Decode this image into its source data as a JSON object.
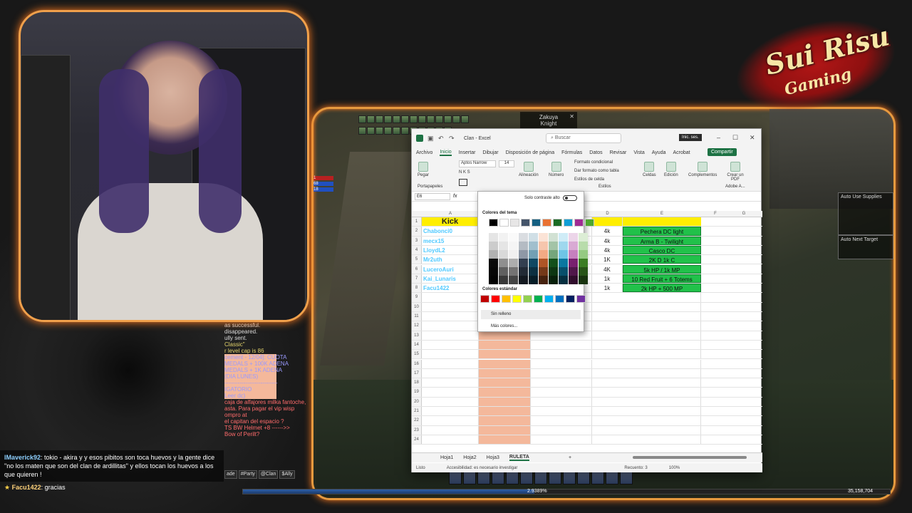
{
  "brand": {
    "title": "Sui Risu",
    "subtitle": "Gaming"
  },
  "game": {
    "target_name": "Zakuya",
    "target_class": "Knight",
    "hp_values": [
      "1",
      "68",
      "18"
    ],
    "chat_lines": [
      {
        "text": "as successful.",
        "cls": "c-w"
      },
      {
        "text": "disappeared.",
        "cls": "c-w"
      },
      {
        "text": "ully sent.",
        "cls": "c-w"
      },
      {
        "text": "",
        "cls": "c-w"
      },
      {
        "text": "",
        "cls": "c-w"
      },
      {
        "text": "Classic\"",
        "cls": "c-y"
      },
      {
        "text": "r level cap is 86",
        "cls": "c-y"
      },
      {
        "text": "cement - 12/04]: CUOTA",
        "cls": "c-b"
      },
      {
        "text": "",
        "cls": "c-b"
      },
      {
        "text": "MEDALS + 100K ADENA",
        "cls": "c-b"
      },
      {
        "text": "MEDALS + 1K ADENA",
        "cls": "c-b"
      },
      {
        "text": "(DIA LUNES)",
        "cls": "c-b"
      },
      {
        "text": "----------------------------",
        "cls": "c-b"
      },
      {
        "text": "IGATORIO",
        "cls": "c-b"
      },
      {
        "text": "Leer dc)",
        "cls": "c-b"
      },
      {
        "text": "",
        "cls": "c-b"
      },
      {
        "text": "caja de alfajores milka fantoche,",
        "cls": "c-r"
      },
      {
        "text": "asta. Para pagar el vip wisp",
        "cls": "c-r"
      },
      {
        "text": "ompro at",
        "cls": "c-r"
      },
      {
        "text": "el capitan del espacio ?",
        "cls": "c-r"
      },
      {
        "text": "TS BW Helmet +8 ------>>",
        "cls": "c-r"
      },
      {
        "text": "Bow of Perilt?",
        "cls": "c-r"
      }
    ],
    "chat_tabs": [
      "ade",
      "#Party",
      "@Clan",
      "$Ally"
    ],
    "supplies_label": "Auto Use Supplies",
    "next_target_label": "Auto Next Target",
    "exp_text": "2.9389%",
    "adena_text": "35,158,704",
    "exp_fraction": 0.45
  },
  "excel": {
    "app_title": "Clan - Excel",
    "search_placeholder": "Buscar",
    "signin": "Inic. ses.",
    "share": "Compartir",
    "menu_tabs": [
      "Archivo",
      "Inicio",
      "Insertar",
      "Dibujar",
      "Disposición de página",
      "Fórmulas",
      "Datos",
      "Revisar",
      "Vista",
      "Ayuda",
      "Acrobat"
    ],
    "active_tab": "Inicio",
    "ribbon": {
      "paste": "Pegar",
      "font": "Aptos Narrow",
      "size": "14",
      "alignment": "Alineación",
      "number": "Número",
      "cond_format": "Formato condicional",
      "table_format": "Dar formato como tabla",
      "cell_styles": "Estilos de celda",
      "styles_group": "Estilos",
      "cells": "Celdas",
      "editing": "Edición",
      "addins": "Complementos",
      "addins_group": "Complementos",
      "create_pdf": "Crear un PDF",
      "adobe": "Adobe A...",
      "clipboard": "Portapapeles"
    },
    "name_box": "E6",
    "columns": [
      "A",
      "D",
      "E",
      "F",
      "G"
    ],
    "kick_header": "Kick",
    "rows": [
      {
        "name": "Chabonci0",
        "amount": "4k",
        "prize": "Pechera DC light"
      },
      {
        "name": "mecx15",
        "amount": "4k",
        "prize": "Arma B - Twilight"
      },
      {
        "name": "LloydL2",
        "amount": "4k",
        "prize": "Casco DC"
      },
      {
        "name": "Mr2uth",
        "amount": "1K",
        "prize": "2K D 1k C"
      },
      {
        "name": "LuceroAuri",
        "amount": "4K",
        "prize": "5k HP / 1k MP"
      },
      {
        "name": "Kai_Lunaris",
        "amount": "1k",
        "prize": "10 Red Fruit + 6 Totems"
      },
      {
        "name": "Facu1422",
        "amount": "1k",
        "prize": "2k HP + 500 MP"
      }
    ],
    "row_numbers": [
      "1",
      "2",
      "3",
      "4",
      "5",
      "6",
      "7",
      "8",
      "9",
      "10",
      "11",
      "12",
      "13",
      "14",
      "15",
      "16",
      "17",
      "18",
      "19",
      "20",
      "21",
      "22",
      "23",
      "24"
    ],
    "sheets": [
      "Hoja1",
      "Hoja2",
      "Hoja3",
      "RULETA"
    ],
    "active_sheet": "RULETA",
    "status_ready": "Listo",
    "status_access": "Accesibilidad: es necesario investigar",
    "status_count": "Recuento: 3",
    "zoom": "100%"
  },
  "color_popup": {
    "high_contrast": "Solo contraste alto",
    "theme_label": "Colores del tema",
    "standard_label": "Colores estándar",
    "no_fill": "Sin relleno",
    "more_colors": "Más colores...",
    "theme_colors": [
      "#000000",
      "#ffffff",
      "#e7e6e6",
      "#44546a",
      "#156082",
      "#e97132",
      "#196b24",
      "#0f9ed5",
      "#a02b93",
      "#4ea72e"
    ],
    "standard_colors": [
      "#c00000",
      "#ff0000",
      "#ffc000",
      "#ffff00",
      "#92d050",
      "#00b050",
      "#00b0f0",
      "#0070c0",
      "#002060",
      "#7030a0"
    ]
  },
  "twitch": {
    "msg1_user": "lMaverick92",
    "msg1_text": ": tokio - akira y y esos pibitos son toca huevos y la gente dice \"no los maten que son del clan de ardillitas\" y ellos tocan los huevos a los que quieren !",
    "msg2_user": "Facu1422",
    "msg2_text": ": gracias"
  }
}
